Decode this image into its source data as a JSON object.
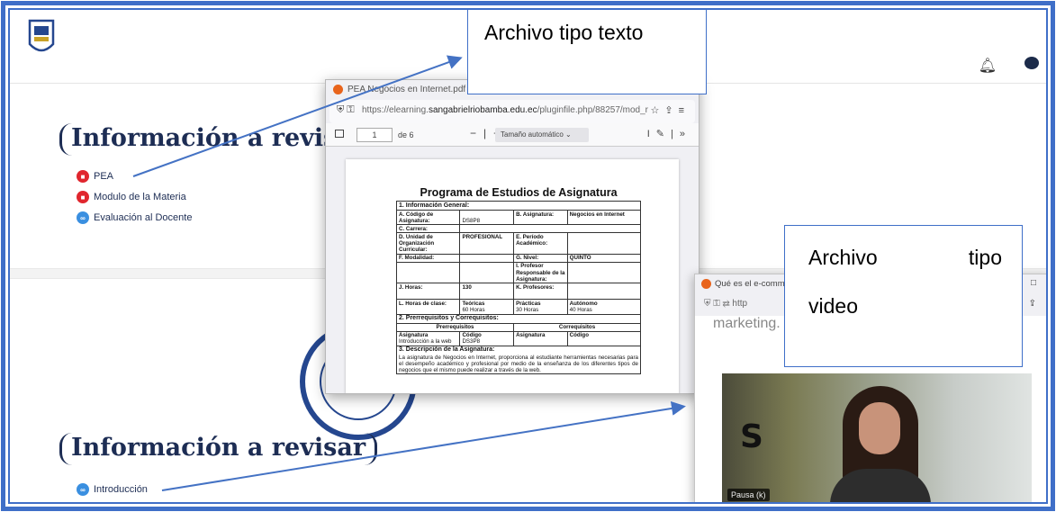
{
  "moodle": {
    "section1_title": "Información a revisar",
    "section1_items": [
      "PEA",
      "Modulo de la Materia",
      "Evaluación al Docente"
    ],
    "section2_title": "Información a revisar",
    "section2_items": [
      "Introducción"
    ]
  },
  "pdf_window": {
    "title": "PEA Negocios en Internet.pdf — Mozilla Firefox",
    "url_prefix": "https://elearning.",
    "url_domain": "sangabrielriobamba.edu.ec",
    "url_suffix": "/pluginfile.php/88257/mod_r",
    "page_current": "1",
    "page_total": "de 6",
    "zoom": "Tamaño automático"
  },
  "document": {
    "title": "Programa de Estudios de Asignatura",
    "s1": "1. Información General:",
    "cod_label": "A. Código de Asignatura:",
    "cod_value": "DS8P8",
    "asig_label": "B. Asignatura:",
    "asig_value": "Negocios en Internet",
    "carrera_label": "C. Carrera:",
    "unidad_label": "D. Unidad de Organización Curricular:",
    "unidad_value": "PROFESIONAL",
    "periodo_label": "E. Período Académico:",
    "modalidad_label": "F. Modalidad:",
    "nivel_label": "G. Nivel:",
    "nivel_value": "QUINTO",
    "profesor_label": "I. Profesor Responsable de la Asignatura:",
    "horas_label": "J. Horas:",
    "horas_value": "130",
    "profesores_label": "K. Profesores:",
    "clase_label": "L. Horas de clase:",
    "teoricas": "Teóricas",
    "teoricas_h": "60 Horas",
    "practicas": "Prácticas",
    "practicas_h": "30 Horas",
    "autonomo": "Autónomo",
    "autonomo_h": "40 Horas",
    "s2": "2. Prerrequisitos y Correquisitos:",
    "prerreq": "Prerrequisitos",
    "correq": "Correquisitos",
    "col_asig": "Asignatura",
    "col_cod": "Código",
    "pre_asig": "Introducción a la web",
    "pre_cod": "DS3P8",
    "s3": "3. Descripción de la Asignatura:",
    "desc": "La asignatura de Negocios en Internet, proporciona al estudiante herramientas necesarias para el desempeño académico y profesional por medio de la enseñanza de los diferentes tipos de negocios que el mismo puede realizar a través de la web."
  },
  "video_window": {
    "title": "Qué es el e-commerce",
    "url": "http",
    "page_text": "marketing.",
    "video_letter": "S",
    "pause_label": "Pausa (k)"
  },
  "callouts": {
    "text_file": "Archivo tipo texto",
    "video_file_w1": "Archivo",
    "video_file_w2": "tipo",
    "video_file_w3": "video"
  },
  "colors": {
    "frame": "#3f6fc8",
    "heading": "#1d2d54",
    "pdf_icon": "#e0262e",
    "link_icon": "#3a8fe0"
  }
}
